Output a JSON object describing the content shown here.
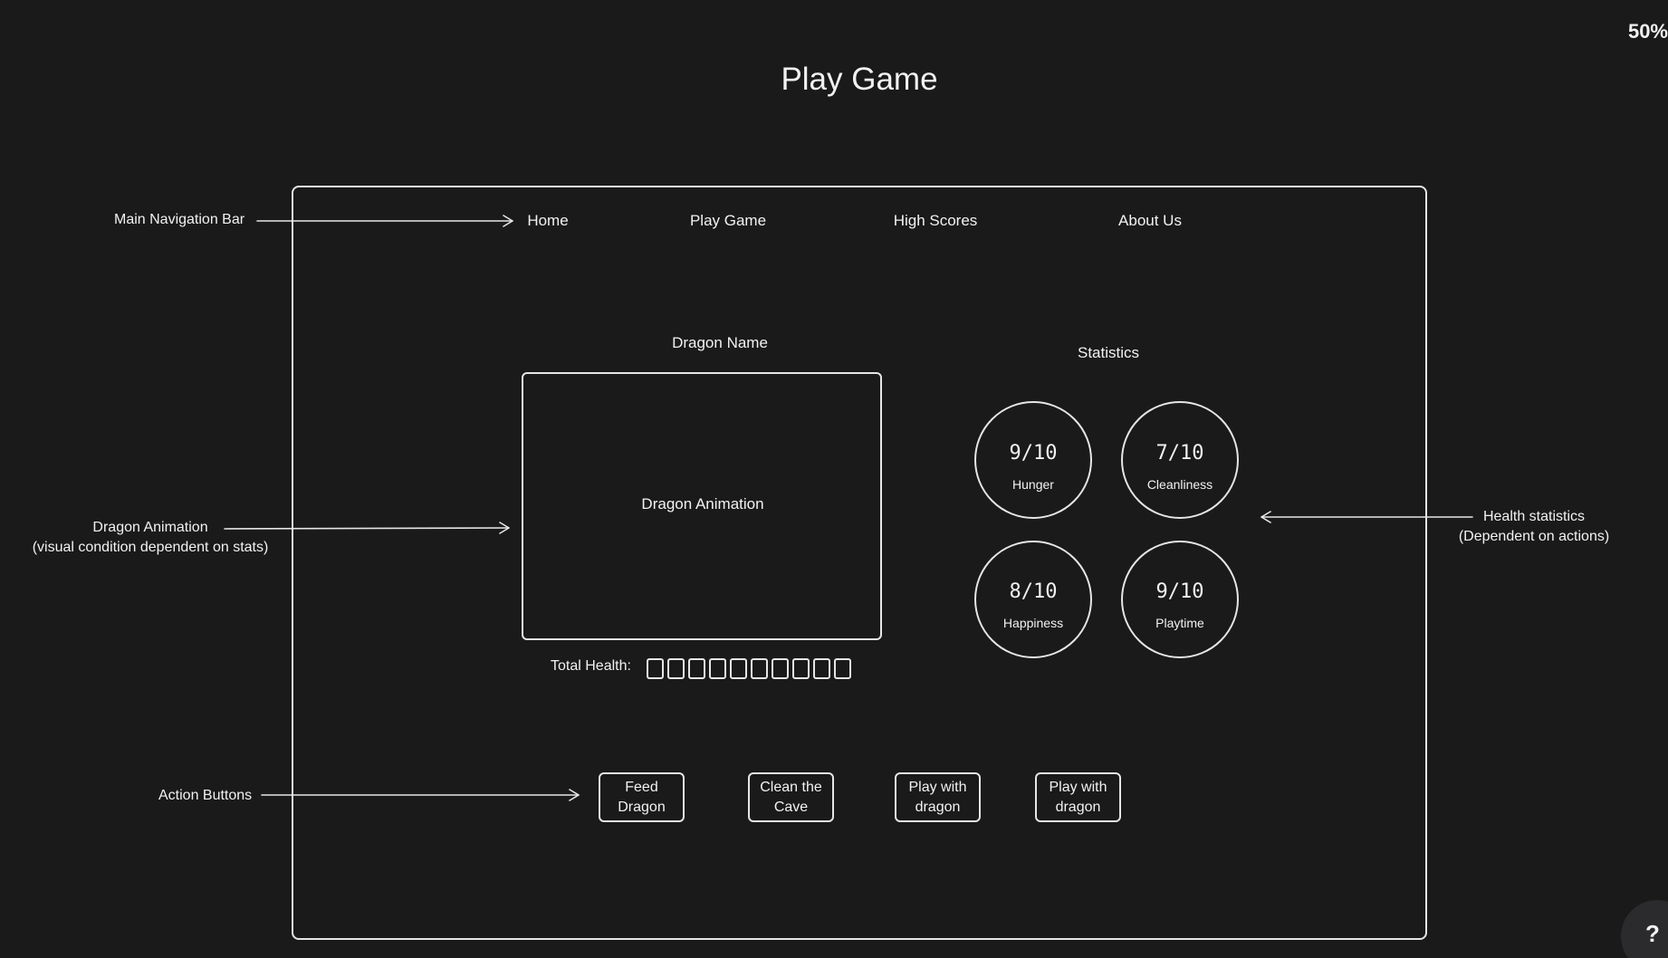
{
  "title": "Play Game",
  "zoom": "50%",
  "nav": [
    "Home",
    "Play Game",
    "High Scores",
    "About Us"
  ],
  "annotations": {
    "nav": "Main Navigation Bar",
    "dragon_line1": "Dragon Animation",
    "dragon_line2": "(visual condition dependent on stats)",
    "actions": "Action Buttons",
    "health_line1": "Health statistics",
    "health_line2": "(Dependent on actions)"
  },
  "dragon_name": "Dragon Name",
  "animation_label": "Dragon Animation",
  "statistics_title": "Statistics",
  "stats": [
    {
      "value": "9/10",
      "label": "Hunger"
    },
    {
      "value": "7/10",
      "label": "Cleanliness"
    },
    {
      "value": "8/10",
      "label": "Happiness"
    },
    {
      "value": "9/10",
      "label": "Playtime"
    }
  ],
  "total_health_label": "Total Health:",
  "health_total": 10,
  "buttons": [
    "Feed\nDragon",
    "Clean the\nCave",
    "Play with\ndragon",
    "Play with\ndragon"
  ],
  "help": "?"
}
